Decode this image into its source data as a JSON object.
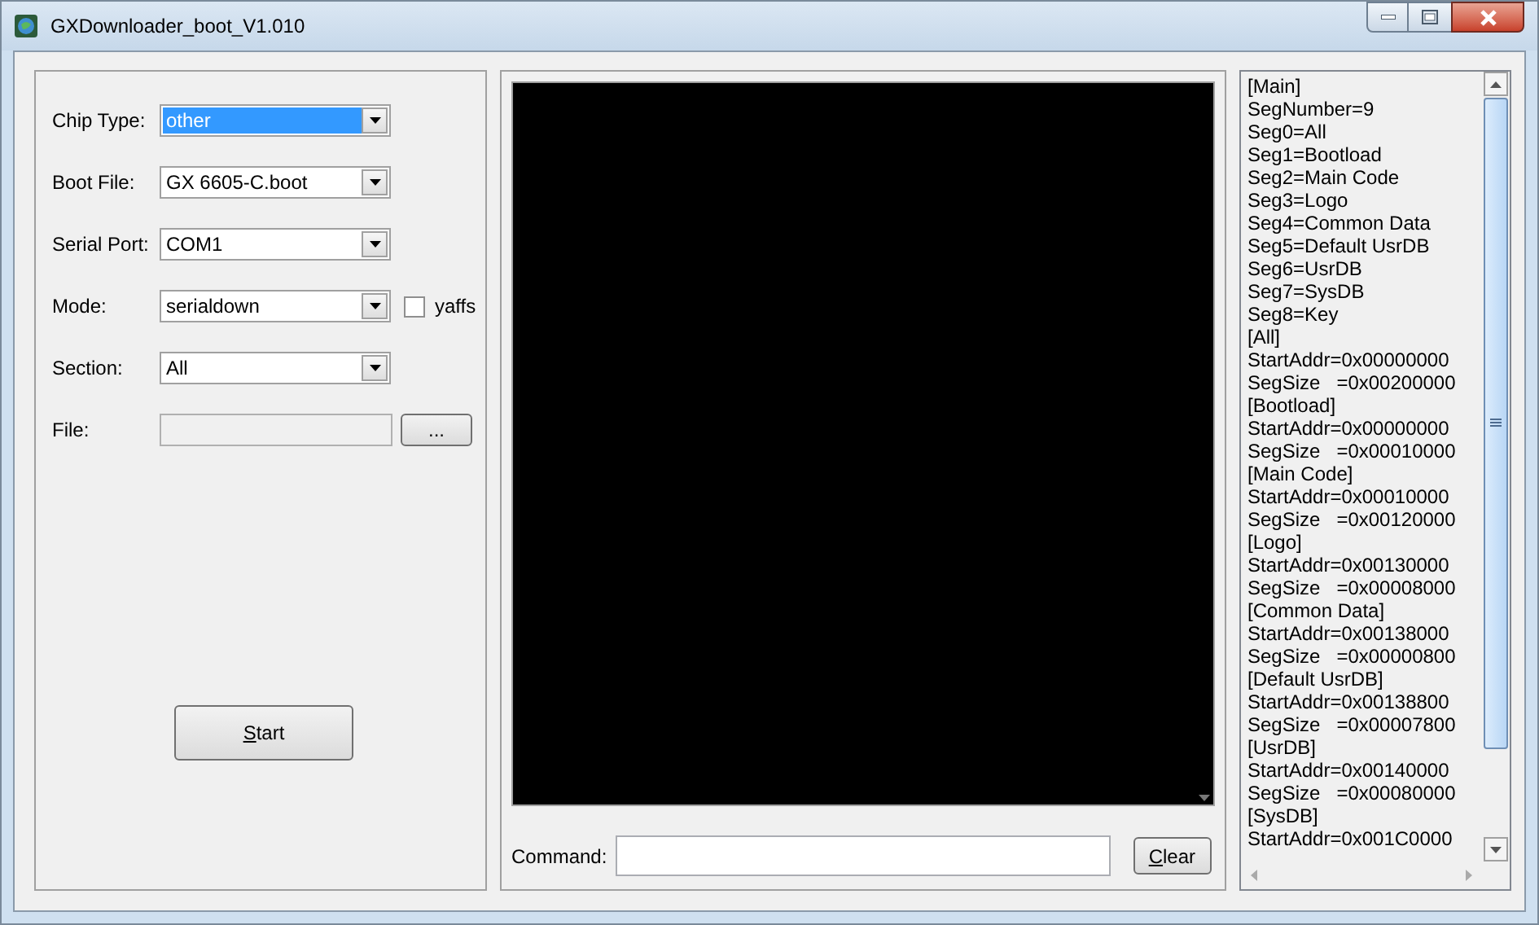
{
  "window": {
    "title": "GXDownloader_boot_V1.010"
  },
  "settings": [
    {
      "kind": "combo",
      "label": "Chip Type:",
      "value": "other",
      "selected": true
    },
    {
      "kind": "combo",
      "label": "Boot File:",
      "value": "GX 6605-C.boot",
      "selected": false
    },
    {
      "kind": "combo",
      "label": "Serial Port:",
      "value": "COM1",
      "selected": false
    },
    {
      "kind": "combo",
      "label": "Mode:",
      "value": "serialdown",
      "selected": false,
      "checkbox": {
        "label": "yaffs",
        "checked": false
      }
    },
    {
      "kind": "combo",
      "label": "Section:",
      "value": "All",
      "selected": false
    },
    {
      "kind": "file",
      "label": "File:",
      "browse": "..."
    }
  ],
  "start_button": {
    "label": "Start",
    "underline_first": true
  },
  "command": {
    "label": "Command:"
  },
  "clear_button": {
    "label": "Clear",
    "underline_first": true
  },
  "config_lines": [
    "[Main]",
    "SegNumber=9",
    "Seg0=All",
    "Seg1=Bootload",
    "Seg2=Main Code",
    "Seg3=Logo",
    "Seg4=Common Data",
    "Seg5=Default UsrDB",
    "Seg6=UsrDB",
    "Seg7=SysDB",
    "Seg8=Key",
    "[All]",
    "StartAddr=0x00000000",
    "SegSize   =0x00200000",
    "[Bootload]",
    "StartAddr=0x00000000",
    "SegSize   =0x00010000",
    "[Main Code]",
    "StartAddr=0x00010000",
    "SegSize   =0x00120000",
    "[Logo]",
    "StartAddr=0x00130000",
    "SegSize   =0x00008000",
    "[Common Data]",
    "StartAddr=0x00138000",
    "SegSize   =0x00000800",
    "[Default UsrDB]",
    "StartAddr=0x00138800",
    "SegSize   =0x00007800",
    "[UsrDB]",
    "StartAddr=0x00140000",
    "SegSize   =0x00080000",
    "[SysDB]",
    "StartAddr=0x001C0000"
  ]
}
